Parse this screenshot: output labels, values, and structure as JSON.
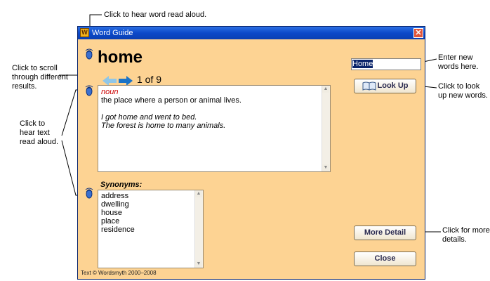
{
  "callouts": {
    "speaker_word": "Click to hear word read aloud.",
    "scroll": "Click to scroll\nthrough different\nresults.",
    "hear_text": "Click to\nhear text\nread aloud.",
    "enter": "Enter new\nwords here.",
    "lookup": "Click to look\nup new words.",
    "more": "Click for more\ndetails."
  },
  "window": {
    "title": "Word Guide",
    "close_glyph": "✕",
    "headword": "home",
    "result_count": "1 of 9",
    "definition": {
      "part_of_speech": "noun",
      "text": "the place where a person or animal lives.",
      "examples": [
        "I got home and went to bed.",
        "The forest is home to many animals."
      ]
    },
    "synonyms_label": "Synonyms:",
    "synonyms": [
      "address",
      "dwelling",
      "house",
      "place",
      "residence"
    ],
    "search": {
      "value": "Home"
    },
    "lookup_label": "Look Up",
    "more_detail_label": "More Detail",
    "close_label": "Close",
    "footer": "Text © Wordsmyth 2000–2008"
  },
  "colors": {
    "window_bg": "#fdd393",
    "accent": "#0b49c9",
    "pos": "#cc0000"
  },
  "icons": [
    "speaker-icon",
    "back-arrow-icon",
    "forward-arrow-icon",
    "book-icon",
    "app-icon",
    "close-icon"
  ]
}
